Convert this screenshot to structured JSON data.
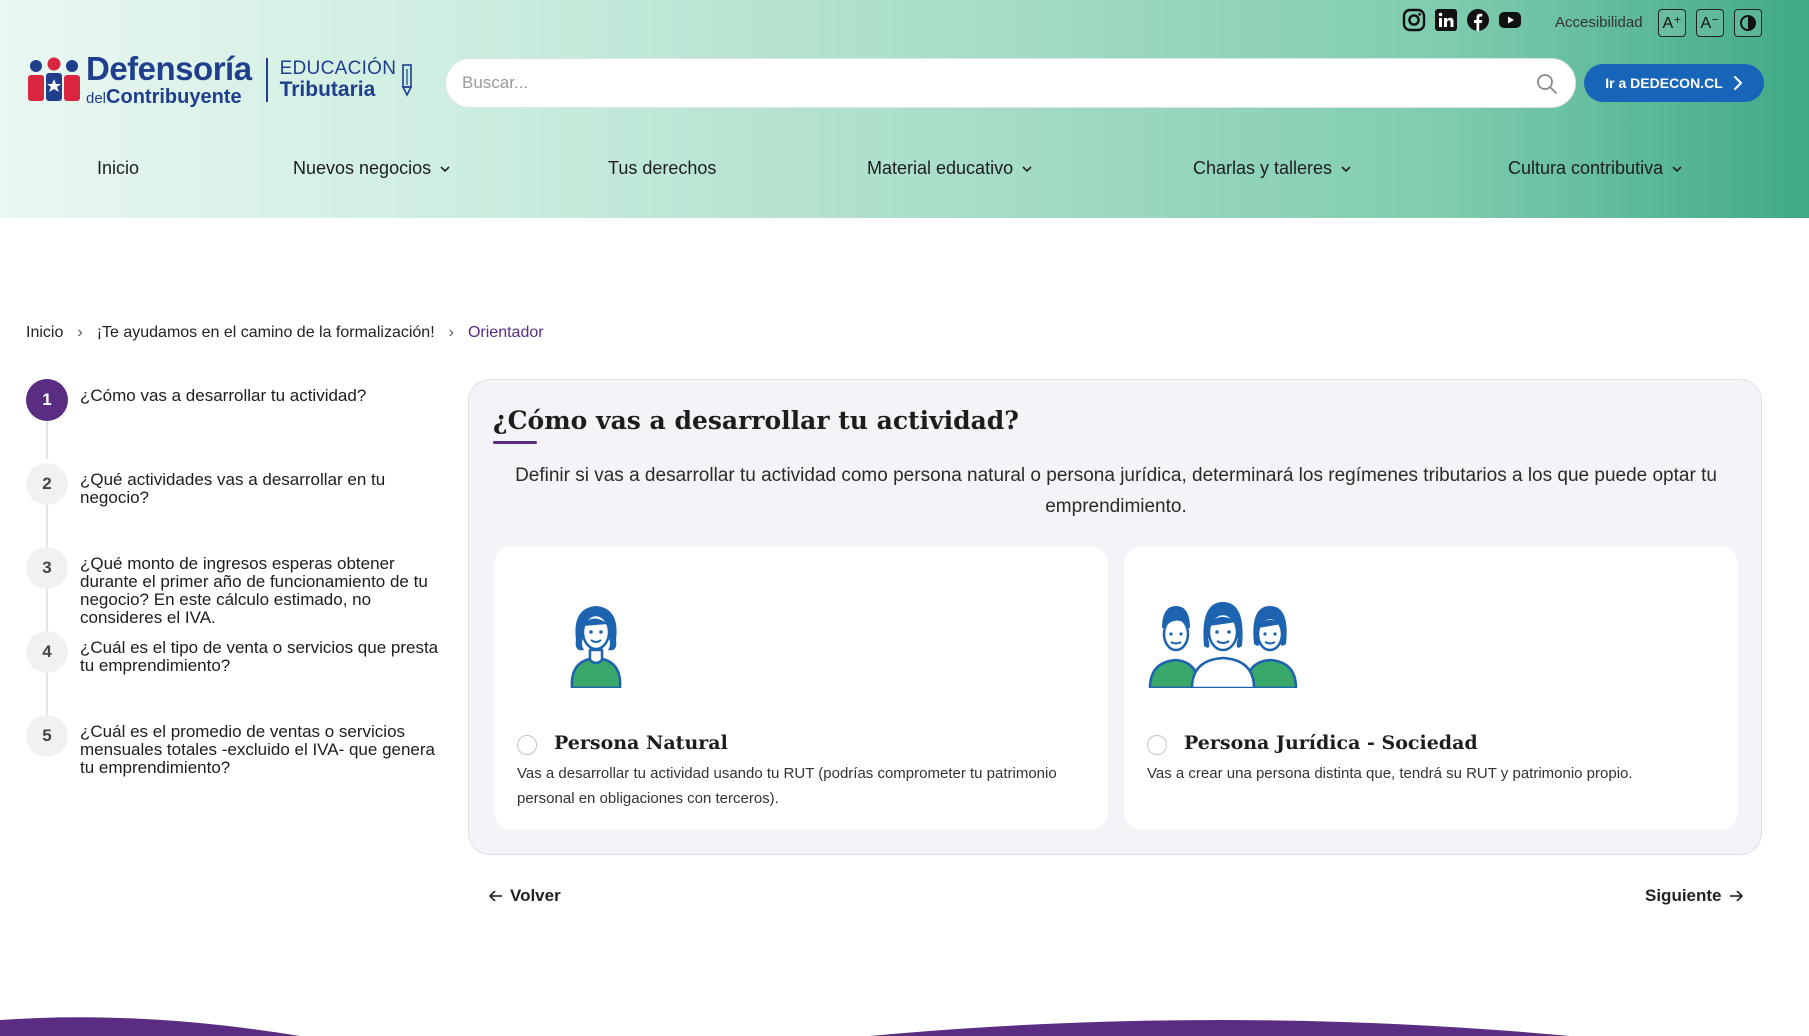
{
  "header": {
    "logo": {
      "line1": "Defensoría",
      "line2_small": "del",
      "line2": "Contribuyente",
      "edu_line1": "EDUCACIÓN",
      "edu_line2": "Tributaria"
    },
    "social": [
      "instagram-icon",
      "linkedin-icon",
      "facebook-icon",
      "youtube-icon"
    ],
    "accessibility_label": "Accesibilidad",
    "acc_increase": "A⁺",
    "acc_decrease": "A⁻",
    "search_placeholder": "Buscar...",
    "dedecon_button": "Ir a DEDECON.CL",
    "brand_color": "#1765b8"
  },
  "nav": [
    {
      "label": "Inicio",
      "dropdown": false
    },
    {
      "label": "Nuevos negocios",
      "dropdown": true
    },
    {
      "label": "Tus derechos",
      "dropdown": false
    },
    {
      "label": "Material educativo",
      "dropdown": true
    },
    {
      "label": "Charlas y talleres",
      "dropdown": true
    },
    {
      "label": "Cultura contributiva",
      "dropdown": true
    }
  ],
  "breadcrumb": [
    "Inicio",
    "¡Te ayudamos en el camino de la formalización!",
    "Orientador"
  ],
  "steps": [
    {
      "num": "1",
      "text": "¿Cómo vas a desarrollar tu actividad?",
      "active": true
    },
    {
      "num": "2",
      "text": "¿Qué actividades vas a desarrollar en tu negocio?",
      "active": false
    },
    {
      "num": "3",
      "text": "¿Qué monto de ingresos esperas obtener durante el primer año de funcionamiento de tu negocio? En este cálculo estimado, no consideres el IVA.",
      "active": false
    },
    {
      "num": "4",
      "text": "¿Cuál es el tipo de venta o servicios que presta tu emprendimiento?",
      "active": false
    },
    {
      "num": "5",
      "text": "¿Cuál es el promedio de ventas o servicios mensuales totales -excluido el IVA- que genera tu emprendimiento?",
      "active": false
    }
  ],
  "question": {
    "title": "¿Cómo vas a desarrollar tu actividad?",
    "description": "Definir si vas a desarrollar tu actividad como persona natural o persona jurídica, determinará los regímenes tributarios a los que puede optar tu emprendimiento.",
    "accent_color": "#5a2d82",
    "options": [
      {
        "title": "Persona Natural",
        "body": "Vas a desarrollar tu actividad usando tu RUT (podrías comprometer tu patrimonio personal en obligaciones con terceros).",
        "selected": false
      },
      {
        "title": "Persona Jurídica - Sociedad",
        "body": "Vas a crear una persona distinta que, tendrá su RUT y patrimonio propio.",
        "selected": false
      }
    ]
  },
  "navigation": {
    "back": "Volver",
    "next": "Siguiente"
  }
}
